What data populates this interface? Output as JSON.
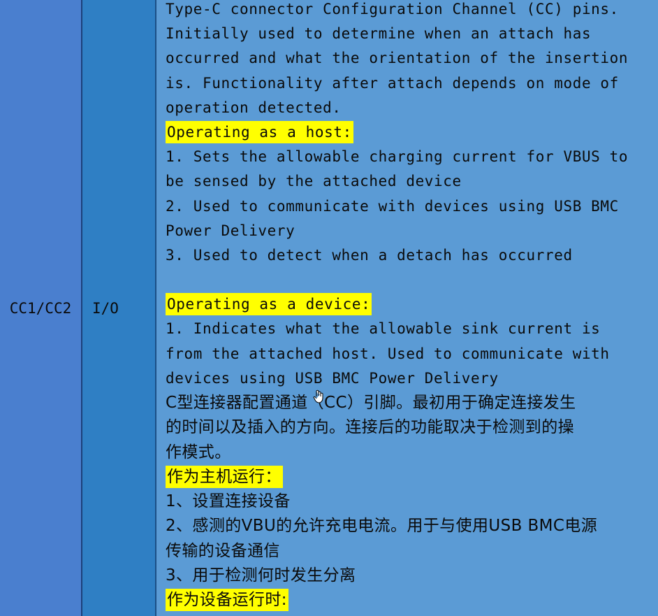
{
  "row": {
    "pin": "CC1/CC2",
    "io": "I/O"
  },
  "description_en": {
    "intro": [
      "Type-C connector Configuration Channel (CC) pins.",
      "Initially used to determine when an attach has",
      "occurred and what the orientation of the insertion",
      "is. Functionality after attach depends on mode of",
      "operation detected."
    ],
    "host_heading": "Operating as a host:",
    "host_items": [
      "1. Sets the allowable charging current for VBUS to",
      "be sensed by the attached device",
      "2. Used to communicate with devices using USB BMC",
      "Power Delivery",
      "3. Used to detect when a detach has occurred"
    ],
    "device_heading": "Operating as a device:",
    "device_items": [
      "1. Indicates what the allowable sink current is",
      "from the attached host. Used to communicate with",
      "devices using USB BMC Power Delivery"
    ]
  },
  "description_cn": {
    "intro": [
      "C型连接器配置通道（CC）引脚。最初用于确定连接发生",
      "的时间以及插入的方向。连接后的功能取决于检测到的操",
      "作模式。"
    ],
    "host_heading": "作为主机运行：",
    "host_items": [
      "1、设置连接设备",
      "2、感测的VBU的允许充电电流。用于与使用USB BMC电源",
      "传输的设备通信",
      "3、用于检测何时发生分离"
    ],
    "device_heading": "作为设备运行时:"
  },
  "icons": {
    "cursor": "hand-cursor-icon"
  }
}
